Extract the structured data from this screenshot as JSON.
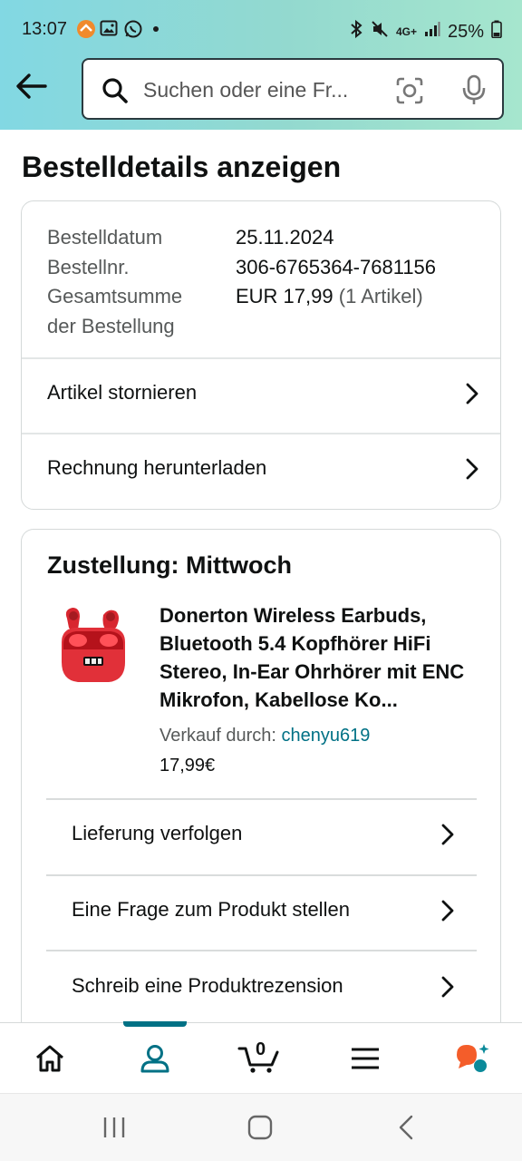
{
  "status_bar": {
    "time": "13:07",
    "battery": "25%",
    "network": "4G+",
    "icons": [
      "notification-app-icon",
      "gallery-icon",
      "whatsapp-icon",
      "dot-icon",
      "bluetooth-icon",
      "mute-icon",
      "signal-icon",
      "battery-icon"
    ]
  },
  "search": {
    "placeholder": "Suchen oder eine Fr..."
  },
  "page": {
    "title": "Bestelldetails anzeigen"
  },
  "order_summary": {
    "order_date_label": "Bestelldatum",
    "order_date": "25.11.2024",
    "order_number_label": "Bestellnr.",
    "order_number": "306-6765364-7681156",
    "total_label_line1": "Gesamtsumme",
    "total_label_line2": "der Bestellung",
    "total_value": "EUR 17,99",
    "item_count": "(1 Artikel)",
    "actions": [
      {
        "label": "Artikel stornieren"
      },
      {
        "label": "Rechnung herunterladen"
      }
    ]
  },
  "delivery": {
    "title": "Zustellung: Mittwoch",
    "product_name": "Donerton Wireless Earbuds, Bluetooth 5.4 Kopfhörer HiFi Stereo, In-Ear Ohrhörer mit ENC Mikrofon, Kabellose Ko...",
    "seller_prefix": "Verkauf durch: ",
    "seller_name": "chenyu619",
    "price": "17,99€",
    "actions": [
      {
        "label": "Lieferung verfolgen"
      },
      {
        "label": "Eine Frage zum Produkt stellen"
      },
      {
        "label": "Schreib eine Produktrezension"
      }
    ]
  },
  "bottom_nav": {
    "cart_count": "0",
    "items": [
      "home-icon",
      "account-icon",
      "cart-icon",
      "menu-icon",
      "assistant-icon"
    ],
    "active": "account-icon"
  },
  "colors": {
    "accent": "#007185",
    "header_gradient_start": "#82d8e3",
    "header_gradient_end": "#a6e6ce",
    "product_red": "#d8262f",
    "assistant_orange": "#f45d2a"
  }
}
